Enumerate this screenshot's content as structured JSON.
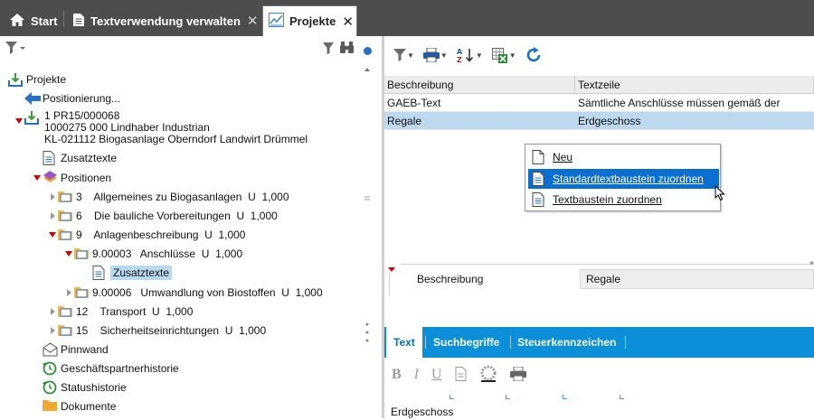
{
  "tabs": [
    {
      "label": "Start",
      "icon": "home-icon",
      "closable": false,
      "active": false
    },
    {
      "label": "Textverwendung verwalten",
      "icon": "document-icon",
      "closable": true,
      "active": false
    },
    {
      "label": "Projekte",
      "icon": "chart-icon",
      "closable": true,
      "active": true
    }
  ],
  "tab_close_glyph": "✕",
  "tree": {
    "root": "Projekte",
    "positioning": "Positionierung...",
    "project": {
      "line1": "1 PR15/000068",
      "line2": "1000275 000 Lindhaber Industrian",
      "line3": "KL-021112 Biogasanlage Oberndorf Landwirt Drümmel"
    },
    "zusatztexte": "Zusatztexte",
    "positionen": "Positionen",
    "items": [
      {
        "label": "3    Allgemeines zu Biogasanlagen  U  1,000"
      },
      {
        "label": "6    Die bauliche Vorbereitungen  U  1,000"
      },
      {
        "label": "9    Anlagenbeschreibung  U  1,000"
      },
      {
        "label": "9.00003   Anschlüsse  U  1,000"
      },
      {
        "label": "Zusatztexte"
      },
      {
        "label": "9.00006   Umwandlung von Biostoffen  U  1,000"
      },
      {
        "label": "12    Transport  U  1,000"
      },
      {
        "label": "15    Sicherheitseinrichtungen  U  1,000"
      }
    ],
    "pinnwand": "Pinnwand",
    "geschaeftspartnerhistorie": "Geschäftspartnerhistorie",
    "statushistorie": "Statushistorie",
    "dokumente": "Dokumente"
  },
  "grid": {
    "headers": [
      "Beschreibung",
      "Textzeile"
    ],
    "rows": [
      [
        "GAEB-Text",
        "Sämtliche Anschlüsse müssen gemäß der"
      ],
      [
        "Regale",
        "Erdgeschoss"
      ]
    ]
  },
  "context_menu": [
    {
      "label": "Neu",
      "highlighted": false
    },
    {
      "label": "Standardtextbaustein zuordnen",
      "highlighted": true
    },
    {
      "label": "Textbaustein zuordnen",
      "highlighted": false
    }
  ],
  "detail": {
    "label": "Beschreibung",
    "value": "Regale"
  },
  "text_tabs": [
    "Text",
    "Suchbegriffe",
    "Steuerkennzeichen"
  ],
  "editor": {
    "format_buttons": [
      "B",
      "I",
      "U"
    ],
    "content": "Erdgeschoss"
  },
  "colors": {
    "tabbar": "#4d4d4d",
    "selection": "#bcd9ef",
    "accent": "#0a8fd8",
    "menu_highlight": "#0a6fd0"
  }
}
